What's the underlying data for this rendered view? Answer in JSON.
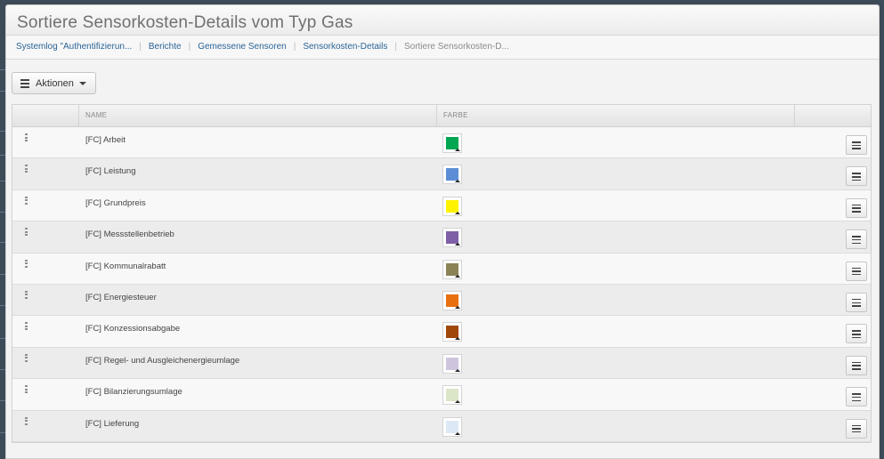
{
  "page": {
    "title": "Sortiere Sensorkosten-Details vom Typ Gas"
  },
  "breadcrumb": {
    "items": [
      "Systemlog \"Authentifizierun...",
      "Berichte",
      "Gemessene Sensoren",
      "Sensorkosten-Details"
    ],
    "current": "Sortiere Sensorkosten-D..."
  },
  "toolbar": {
    "actions_label": "Aktionen",
    "actions_icon": "hamburger-icon",
    "caret_icon": "caret-down-icon"
  },
  "table": {
    "columns": [
      "",
      "NAME",
      "FARBE",
      ""
    ],
    "rows": [
      {
        "name": "[FC] Arbeit",
        "color": "#00a651"
      },
      {
        "name": "[FC] Leistung",
        "color": "#5b8ed6"
      },
      {
        "name": "[FC] Grundpreis",
        "color": "#fff200"
      },
      {
        "name": "[FC] Messstellenbetrieb",
        "color": "#7f5fa6"
      },
      {
        "name": "[FC] Kommunalrabatt",
        "color": "#8c8257"
      },
      {
        "name": "[FC] Energiesteuer",
        "color": "#e8700f"
      },
      {
        "name": "[FC] Konzessionsabgabe",
        "color": "#a0480a"
      },
      {
        "name": "[FC] Regel- und Ausgleichenergieumlage",
        "color": "#cfc4dd"
      },
      {
        "name": "[FC] Bilanzierungsumlage",
        "color": "#dbe5c8"
      },
      {
        "name": "[FC] Lieferung",
        "color": "#dde8f6"
      }
    ],
    "row_menu_icon": "row-menu-icon",
    "drag_icon": "drag-handle-icon"
  }
}
